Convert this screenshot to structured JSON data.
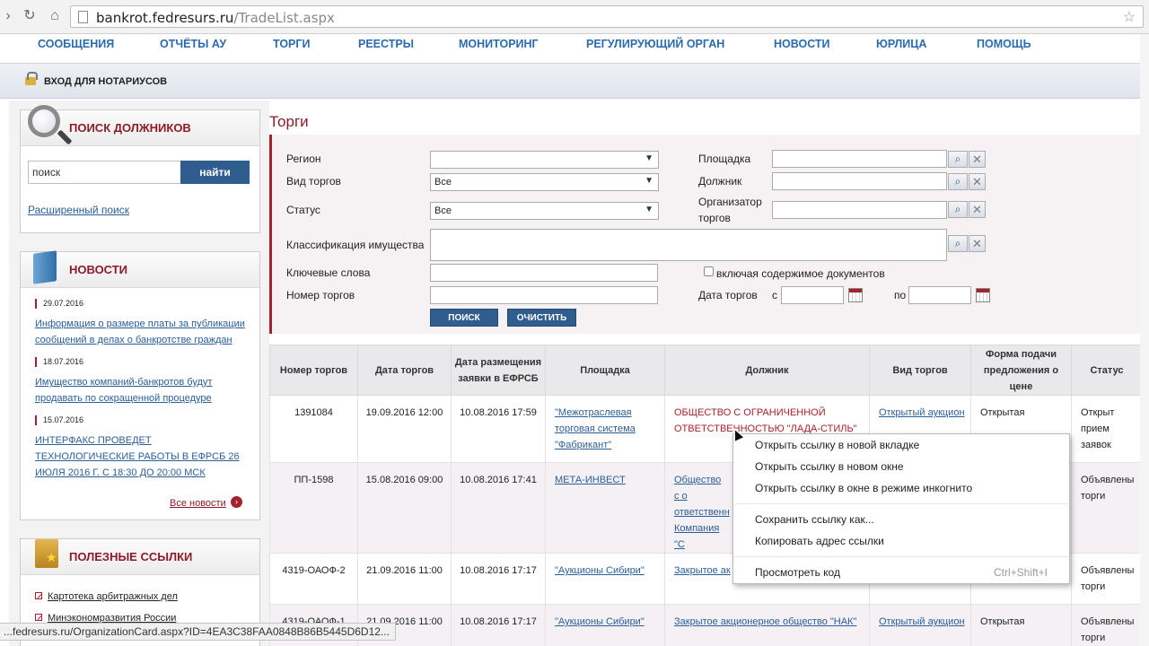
{
  "browser": {
    "url_host": "bankrot.fedresurs.ru",
    "url_path": "/TradeList.aspx",
    "status_url": "...fedresurs.ru/OrganizationCard.aspx?ID=4EA3C38FAA0848B86B5445D6D12..."
  },
  "topnav": [
    "СООБЩЕНИЯ",
    "ОТЧЁТЫ АУ",
    "ТОРГИ",
    "РЕЕСТРЫ",
    "МОНИТОРИНГ",
    "РЕГУЛИРУЮЩИЙ ОРГАН",
    "НОВОСТИ",
    "ЮРЛИЦА",
    "ПОМОЩЬ"
  ],
  "notary_link": "ВХОД ДЛЯ НОТАРИУСОВ",
  "debtor_search": {
    "title": "ПОИСК ДОЛЖНИКОВ",
    "input_value": "поиск",
    "button": "найти",
    "advanced_link": "Расширенный поиск"
  },
  "news": {
    "title": "НОВОСТИ",
    "items": [
      {
        "date": "29.07.2016",
        "text": "Информация о размере платы за публикации сообщений в делах о банкротстве граждан"
      },
      {
        "date": "18.07.2016",
        "text": "Имущество компаний-банкротов будут продавать по сокращенной процедуре"
      },
      {
        "date": "15.07.2016",
        "text": "ИНТЕРФАКС ПРОВЕДЕТ ТЕХНОЛОГИЧЕСКИЕ РАБОТЫ В ЕФРСБ 26 ИЮЛЯ 2016 Г. С 18:30 ДО 20:00 МСК"
      }
    ],
    "all_news": "Все новости"
  },
  "useful_links": {
    "title": "ПОЛЕЗНЫЕ ССЫЛКИ",
    "items": [
      "Картотека арбитражных дел",
      "Минэкономразвития России"
    ]
  },
  "page_title": "Торги",
  "filters": {
    "region_label": "Регион",
    "region_value": "",
    "trade_type_label": "Вид торгов",
    "trade_type_value": "Все",
    "status_label": "Статус",
    "status_value": "Все",
    "classification_label": "Классификация имущества",
    "keywords_label": "Ключевые слова",
    "trade_number_label": "Номер торгов",
    "platform_label": "Площадка",
    "debtor_label": "Должник",
    "organizer_label_line1": "Организатор",
    "organizer_label_line2": "торгов",
    "include_docs_label": "включая содержимое документов",
    "trade_date_label": "Дата торгов",
    "date_from_label": "с",
    "date_to_label": "по",
    "search_button": "ПОИСК",
    "clear_button": "ОЧИСТИТЬ"
  },
  "table": {
    "headers": [
      "Номер торгов",
      "Дата торгов",
      "Дата размещения заявки в ЕФРСБ",
      "Площадка",
      "Должник",
      "Вид торгов",
      "Форма подачи предложения о цене",
      "Статус"
    ],
    "rows": [
      {
        "number": "1391084",
        "trade_date": "19.09.2016 12:00",
        "placed": "10.08.2016 17:59",
        "platform": "\"Межотраслевая торговая система \"Фабрикант\"",
        "debtor": "ОБЩЕСТВО С ОГРАНИЧЕННОЙ ОТВЕТСТВЕННОСТЬЮ \"ЛАДА-СТИЛЬ\"",
        "trade_type": "Открытый аукцион",
        "form": "Открытая",
        "status": "Открыт прием заявок"
      },
      {
        "number": "ПП-1598",
        "trade_date": "15.08.2016 09:00",
        "placed": "10.08.2016 17:41",
        "platform": "МЕТА-ИНВЕСТ",
        "debtor": "Общество с о ответственн Компания \"С",
        "trade_type": "",
        "form": "",
        "status": "Объявлены торги"
      },
      {
        "number": "4319-ОАОФ-2",
        "trade_date": "21.09.2016 11:00",
        "placed": "10.08.2016 17:17",
        "platform": "\"Аукционы Сибири\"",
        "debtor": "Закрытое ак",
        "trade_type": "",
        "form": "",
        "status": "Объявлены торги"
      },
      {
        "number": "4319-ОАОФ-1",
        "trade_date": "21.09.2016 11:00",
        "placed": "10.08.2016 17:17",
        "platform": "\"Аукционы Сибири\"",
        "debtor": "Закрытое акционерное общество \"НАК\"",
        "trade_type": "Открытый аукцион",
        "form": "Открытая",
        "status": "Объявлены торги"
      }
    ]
  },
  "context_menu": {
    "open_new_tab": "Открыть ссылку в новой вкладке",
    "open_new_window": "Открыть ссылку в новом окне",
    "open_incognito": "Открыть ссылку в окне в режиме инкогнито",
    "save_link": "Сохранить ссылку как...",
    "copy_link": "Копировать адрес ссылки",
    "inspect": "Просмотреть код",
    "inspect_shortcut": "Ctrl+Shift+I"
  }
}
